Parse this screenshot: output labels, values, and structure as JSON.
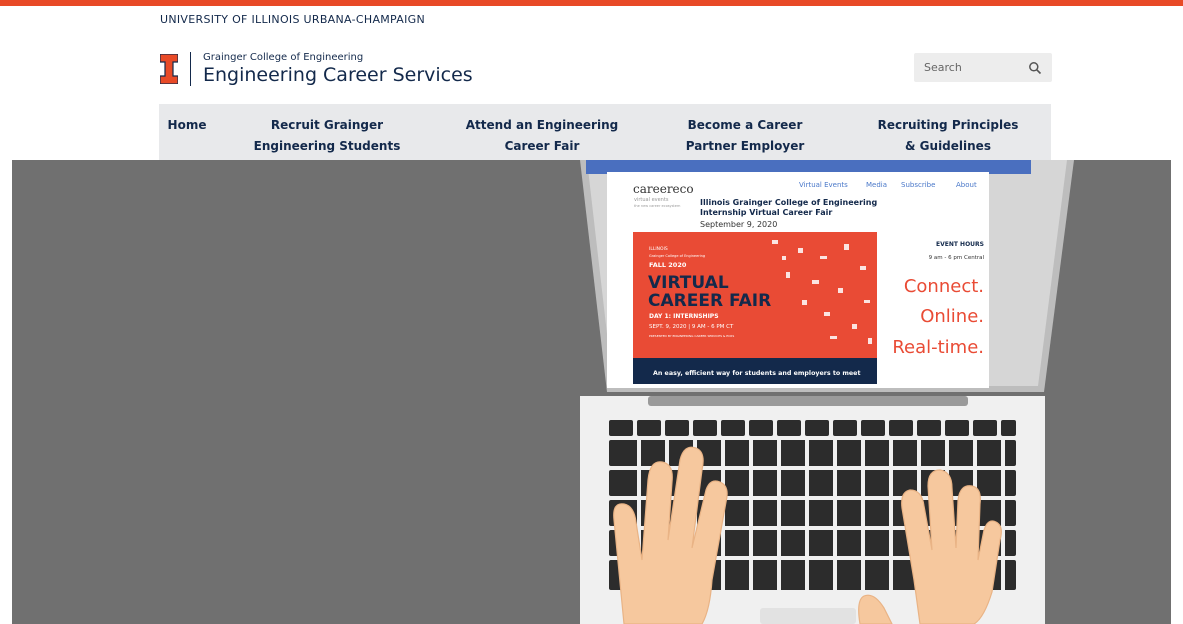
{
  "header": {
    "university": "UNIVERSITY OF ILLINOIS URBANA-CHAMPAIGN",
    "college": "Grainger College of Engineering",
    "department": "Engineering Career Services",
    "brand_color": "#e84a27",
    "navy": "#13294b"
  },
  "search": {
    "placeholder": "Search",
    "icon": "search-icon"
  },
  "nav": {
    "items": [
      {
        "label": "Home"
      },
      {
        "label": "Recruit Grainger Engineering Students"
      },
      {
        "label": "Attend an Engineering Career Fair"
      },
      {
        "label": "Become a Career Partner Employer"
      },
      {
        "label": "Recruiting Principles & Guidelines"
      }
    ]
  },
  "hero": {
    "screen": {
      "site_logo": "careereco",
      "site_tagline": "virtual events",
      "site_sub": "the new career ecosystem",
      "nav": [
        "Virtual Events",
        "Media",
        "Subscribe",
        "About"
      ],
      "event_title_line1": "Illinois Grainger College of Engineering",
      "event_title_line2": "Internship Virtual Career Fair",
      "event_date": "September 9, 2020",
      "banner": {
        "illinois": "ILLINOIS",
        "college": "Grainger College of Engineering",
        "term": "FALL 2020",
        "title_line1": "VIRTUAL",
        "title_line2": "CAREER FAIR",
        "day": "DAY 1: INTERNSHIPS",
        "when": "SEPT. 9, 2020  |  9 AM - 6 PM CT",
        "presented": "PRESENTED BY ENGINEERING CAREER SERVICES & ECRS"
      },
      "event_hours_label": "EVENT HOURS",
      "event_hours": "9 am - 6 pm Central",
      "slogan": [
        "Connect.",
        "Online.",
        "Real-time."
      ],
      "footer": "An easy, efficient way for students and employers to meet"
    }
  }
}
